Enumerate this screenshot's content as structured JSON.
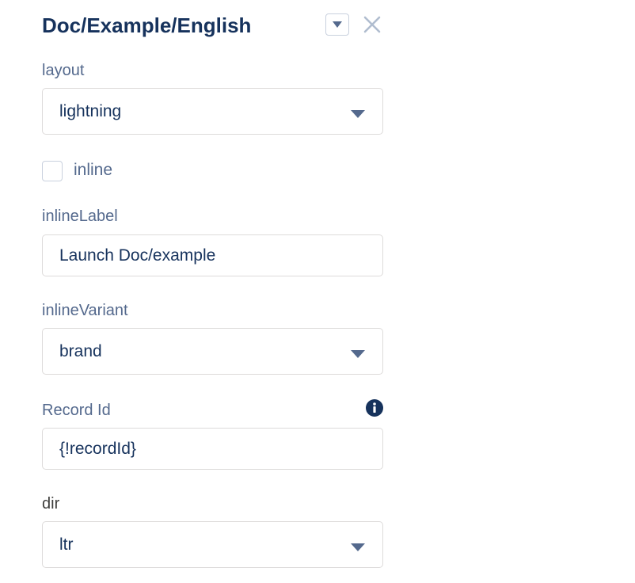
{
  "header": {
    "title": "Doc/Example/English"
  },
  "fields": {
    "layout": {
      "label": "layout",
      "value": "lightning"
    },
    "inline": {
      "label": "inline",
      "checked": false
    },
    "inlineLabel": {
      "label": "inlineLabel",
      "value": "Launch Doc/example"
    },
    "inlineVariant": {
      "label": "inlineVariant",
      "value": "brand"
    },
    "recordId": {
      "label": "Record Id",
      "value": "{!recordId}"
    },
    "dir": {
      "label": "dir",
      "value": "ltr"
    }
  },
  "icons": {
    "title_dropdown": "chevron-down-icon",
    "close": "close-icon",
    "info": "info-icon",
    "select_chevron": "chevron-down-icon"
  },
  "colors": {
    "title": "#16325c",
    "label": "#54698d",
    "border": "#dddbda",
    "icon": "#54698d"
  }
}
